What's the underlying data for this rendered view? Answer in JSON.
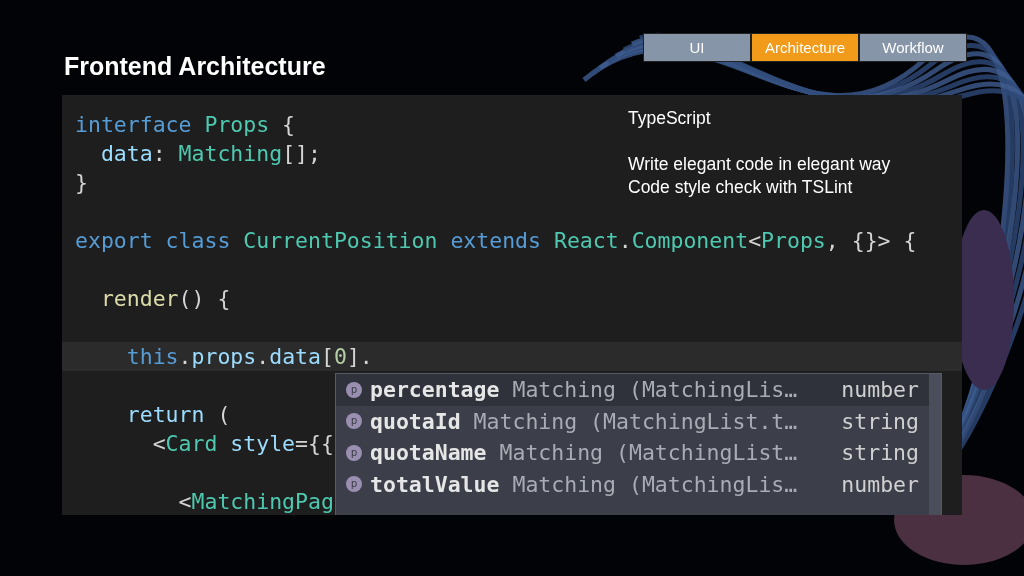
{
  "slide": {
    "title": "Frontend Architecture"
  },
  "tabs": [
    {
      "label": "UI",
      "selected": false
    },
    {
      "label": "Architecture",
      "selected": true
    },
    {
      "label": "Workflow",
      "selected": false
    }
  ],
  "editor": {
    "lines": [
      {
        "kind": "code",
        "highlighted": false,
        "tokens": [
          {
            "kind": "keyword",
            "text": "interface"
          },
          {
            "kind": "type",
            "text": " Props"
          },
          {
            "kind": "punct",
            "text": " {"
          }
        ]
      },
      {
        "kind": "code",
        "highlighted": false,
        "tokens": [
          {
            "kind": "plain",
            "text": "  data"
          },
          {
            "kind": "punct",
            "text": ": "
          },
          {
            "kind": "type",
            "text": "Matching"
          },
          {
            "kind": "punct",
            "text": "[];"
          }
        ]
      },
      {
        "kind": "code",
        "highlighted": false,
        "tokens": [
          {
            "kind": "punct",
            "text": "}"
          }
        ]
      },
      {
        "kind": "blank"
      },
      {
        "kind": "code",
        "highlighted": false,
        "tokens": [
          {
            "kind": "keyword",
            "text": "export class"
          },
          {
            "kind": "type",
            "text": " CurrentPosition"
          },
          {
            "kind": "keyword",
            "text": " extends"
          },
          {
            "kind": "type",
            "text": " React"
          },
          {
            "kind": "punct",
            "text": "."
          },
          {
            "kind": "type",
            "text": "Component"
          },
          {
            "kind": "punct",
            "text": "<"
          },
          {
            "kind": "type",
            "text": "Props"
          },
          {
            "kind": "punct",
            "text": ", {}> {"
          }
        ]
      },
      {
        "kind": "blank"
      },
      {
        "kind": "code",
        "highlighted": false,
        "tokens": [
          {
            "kind": "func",
            "text": "  render"
          },
          {
            "kind": "punct",
            "text": "() {"
          }
        ]
      },
      {
        "kind": "blank"
      },
      {
        "kind": "code",
        "highlighted": true,
        "tokens": [
          {
            "kind": "keyword",
            "text": "    this"
          },
          {
            "kind": "punct",
            "text": "."
          },
          {
            "kind": "plain",
            "text": "props"
          },
          {
            "kind": "punct",
            "text": "."
          },
          {
            "kind": "plain",
            "text": "data"
          },
          {
            "kind": "punct",
            "text": "["
          },
          {
            "kind": "number",
            "text": "0"
          },
          {
            "kind": "punct",
            "text": "]."
          }
        ]
      },
      {
        "kind": "blank"
      },
      {
        "kind": "code",
        "highlighted": false,
        "tokens": [
          {
            "kind": "plain",
            "text": "    return"
          },
          {
            "kind": "punct",
            "text": " ("
          }
        ]
      },
      {
        "kind": "code",
        "highlighted": false,
        "tokens": [
          {
            "kind": "punct",
            "text": "      <"
          },
          {
            "kind": "type",
            "text": "Card"
          },
          {
            "kind": "plain",
            "text": " style"
          },
          {
            "kind": "punct",
            "text": "={{"
          }
        ]
      },
      {
        "kind": "blank"
      },
      {
        "kind": "code",
        "highlighted": false,
        "tokens": [
          {
            "kind": "punct",
            "text": "        <"
          },
          {
            "kind": "type",
            "text": "MatchingPag"
          }
        ]
      }
    ],
    "completion": [
      {
        "icon_letter": "p",
        "name": "percentage",
        "detail": "Matching (MatchingLis…",
        "type": "number",
        "selected": true
      },
      {
        "icon_letter": "p",
        "name": "quotaId",
        "detail": "Matching (MatchingList.t…",
        "type": "string",
        "selected": false
      },
      {
        "icon_letter": "p",
        "name": "quotaName",
        "detail": "Matching (MatchingList…",
        "type": "string",
        "selected": false
      },
      {
        "icon_letter": "p",
        "name": "totalValue",
        "detail": "Matching (MatchingLis…",
        "type": "number",
        "selected": false
      }
    ]
  },
  "notes": {
    "heading": "TypeScript",
    "lines": [
      "Write elegant code in elegant way",
      "Code style check with TSLint"
    ]
  }
}
